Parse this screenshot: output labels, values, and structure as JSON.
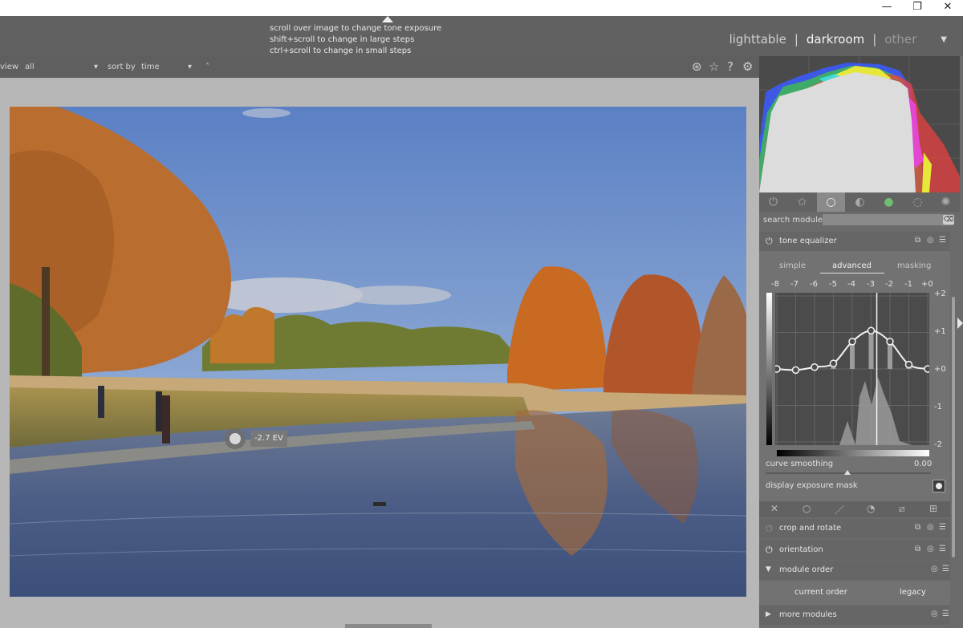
{
  "window": {
    "minimize": "—",
    "restore": "❐",
    "close": "✕"
  },
  "tooltip": {
    "lines": [
      "scroll over image to change tone exposure",
      "shift+scroll to change in large steps",
      "ctrl+scroll to change in small steps"
    ]
  },
  "views": {
    "lighttable": "lighttable",
    "darkroom": "darkroom",
    "other": "other",
    "separator": "|",
    "active": "darkroom"
  },
  "filterbar": {
    "view_label": "view",
    "view_value": "all",
    "sortby_label": "sort by",
    "sortby_value": "time",
    "dropdown_caret": "▾",
    "sort_dir": "˄",
    "icons": [
      "color-picker-icon",
      "star-icon",
      "help-icon",
      "gear-icon"
    ]
  },
  "image": {
    "ev_label": "-2.7 EV"
  },
  "module_groups": {
    "icons": [
      "power-icon",
      "favorite-star-icon",
      "tone-group-icon",
      "base-group-icon",
      "color-group-icon",
      "correct-group-icon",
      "effect-group-icon"
    ],
    "active_index": 2
  },
  "search": {
    "label": "search module",
    "value": "",
    "clear": "⌫"
  },
  "tone_equalizer": {
    "name": "tone equalizer",
    "tabs": [
      "simple",
      "advanced",
      "masking"
    ],
    "active_tab": "advanced",
    "ev_ticks": [
      "-8",
      "-7",
      "-6",
      "-5",
      "-4",
      "-3",
      "-2",
      "-1",
      "+0"
    ],
    "gain_ticks": [
      "+2",
      "+1",
      "+0",
      "-1",
      "-2"
    ],
    "curve_ev_gain": [
      {
        "ev": -8,
        "gain": 0
      },
      {
        "ev": -7,
        "gain": -0.03
      },
      {
        "ev": -6,
        "gain": 0.05
      },
      {
        "ev": -5,
        "gain": 0.15
      },
      {
        "ev": -4,
        "gain": 0.75
      },
      {
        "ev": -3,
        "gain": 1.05
      },
      {
        "ev": -2,
        "gain": 0.75
      },
      {
        "ev": -1,
        "gain": 0.12
      },
      {
        "ev": 0,
        "gain": 0
      }
    ],
    "cursor_ev": -2.7,
    "curve_smoothing_label": "curve smoothing",
    "curve_smoothing_value": "0.00",
    "display_mask_label": "display exposure mask"
  },
  "masktools": {
    "icons": [
      "mask-off-icon",
      "circle-mask-icon",
      "brush-mask-icon",
      "path-mask-icon",
      "gradient-mask-icon",
      "raster-mask-icon"
    ]
  },
  "modules": [
    {
      "name": "crop and rotate",
      "enabled": false
    },
    {
      "name": "orientation",
      "enabled": true
    }
  ],
  "module_order": {
    "name": "module order",
    "current": "current order",
    "legacy": "legacy"
  },
  "more_modules": {
    "name": "more modules"
  },
  "colors": {
    "panel_bg": "#6b6b6b",
    "center_bg": "#b7b7b7",
    "histo_red": "#e84040",
    "histo_green": "#3fc83f",
    "histo_blue": "#3b5bff",
    "histo_yellow": "#e7e73a",
    "histo_magenta": "#e846e0",
    "histo_cyan": "#3be2e2"
  }
}
